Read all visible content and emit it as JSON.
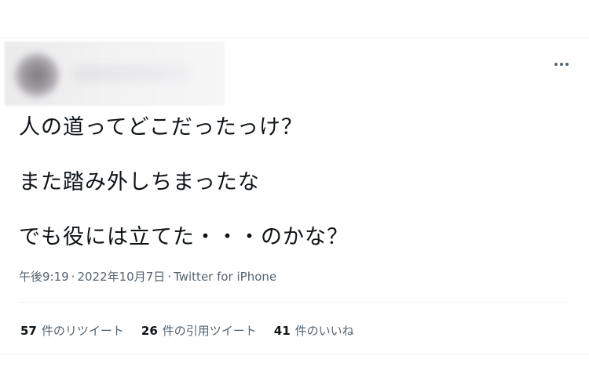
{
  "tweet": {
    "lines": [
      "人の道ってどこだったっけ？",
      "また踏み外しちまったな",
      "でも役には立てた・・・のかな？"
    ],
    "time": "午後9:19",
    "date": "2022年10月7日",
    "source": "Twitter for iPhone",
    "separator": "·"
  },
  "stats": {
    "retweets": {
      "count": "57",
      "label": "件のリツイート"
    },
    "quotes": {
      "count": "26",
      "label": "件の引用ツイート"
    },
    "likes": {
      "count": "41",
      "label": "件のいいね"
    }
  },
  "icons": {
    "more": "more-horizontal-icon"
  },
  "colors": {
    "text": "#0f1419",
    "secondary": "#536471",
    "divider": "#eff3f4"
  }
}
